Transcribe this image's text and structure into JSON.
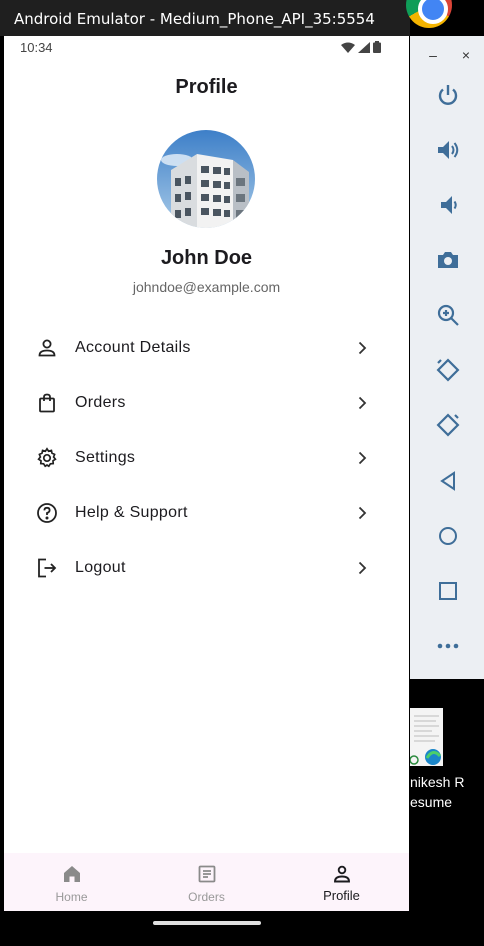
{
  "window": {
    "title": "Android Emulator - Medium_Phone_API_35:5554",
    "minimize_label": "–",
    "close_label": "×"
  },
  "status_bar": {
    "time": "10:34"
  },
  "header": {
    "title": "Profile"
  },
  "profile": {
    "name": "John Doe",
    "email": "johndoe@example.com"
  },
  "menu": {
    "items": [
      {
        "label": "Account Details",
        "icon": "person-icon"
      },
      {
        "label": "Orders",
        "icon": "shopping-bag-icon"
      },
      {
        "label": "Settings",
        "icon": "gear-icon"
      },
      {
        "label": "Help & Support",
        "icon": "help-circle-icon"
      },
      {
        "label": "Logout",
        "icon": "logout-icon"
      }
    ]
  },
  "bottom_nav": {
    "items": [
      {
        "label": "Home",
        "icon": "home-icon",
        "active": false
      },
      {
        "label": "Orders",
        "icon": "list-icon",
        "active": false
      },
      {
        "label": "Profile",
        "icon": "person-icon",
        "active": true
      }
    ]
  },
  "emulator_toolbar": {
    "buttons": [
      "power-icon",
      "volume-up-icon",
      "volume-down-icon",
      "camera-icon",
      "zoom-icon",
      "rotate-left-icon",
      "rotate-right-icon",
      "back-icon",
      "home-icon",
      "overview-icon",
      "more-icon"
    ]
  },
  "desktop": {
    "file_label_line1": "nikesh R",
    "file_label_line2": "esume"
  },
  "colors": {
    "accent_nav_bg": "#fdf4fb",
    "text_primary": "#1c1b1f",
    "text_secondary": "#666666"
  }
}
